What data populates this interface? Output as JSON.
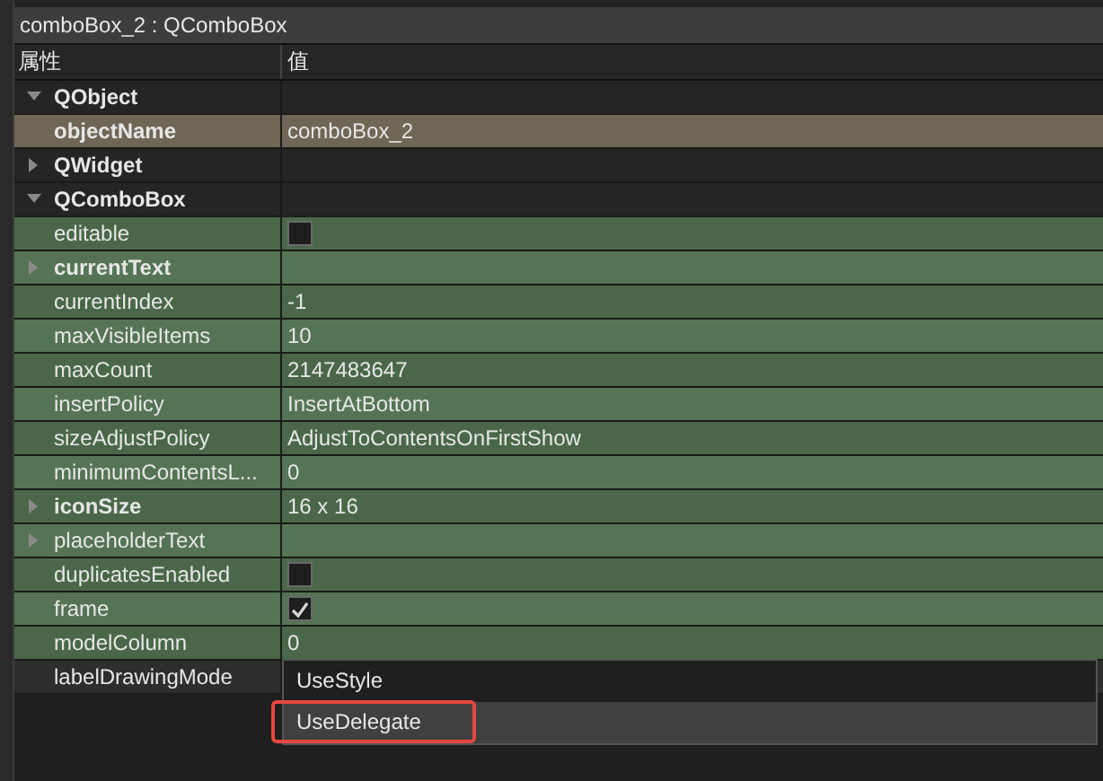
{
  "title": "comboBox_2 : QComboBox",
  "header": {
    "column_1": "属性",
    "column_2": "值"
  },
  "rows": [
    {
      "kind": "group",
      "name": "QObject",
      "expanded": true,
      "selected": false
    },
    {
      "kind": "property",
      "name": "objectName",
      "bold": true,
      "value": "comboBox_2",
      "selected": true
    },
    {
      "kind": "group",
      "name": "QWidget",
      "expanded": false,
      "selected": false
    },
    {
      "kind": "group",
      "name": "QComboBox",
      "expanded": true,
      "selected": false
    },
    {
      "kind": "property",
      "name": "editable",
      "bold": false,
      "checked": false,
      "selected": false
    },
    {
      "kind": "property",
      "name": "currentText",
      "bold": true,
      "expanded": false,
      "selected": false
    },
    {
      "kind": "property",
      "name": "currentIndex",
      "bold": false,
      "value": "-1",
      "selected": false
    },
    {
      "kind": "property",
      "name": "maxVisibleItems",
      "bold": false,
      "value": "10",
      "selected": false
    },
    {
      "kind": "property",
      "name": "maxCount",
      "bold": false,
      "value": "2147483647",
      "selected": false
    },
    {
      "kind": "property",
      "name": "insertPolicy",
      "bold": false,
      "value": "InsertAtBottom",
      "selected": false
    },
    {
      "kind": "property",
      "name": "sizeAdjustPolicy",
      "bold": false,
      "value": "AdjustToContentsOnFirstShow",
      "selected": false
    },
    {
      "kind": "property",
      "name": "minimumContentsL...",
      "bold": false,
      "value": "0",
      "selected": false
    },
    {
      "kind": "property",
      "name": "iconSize",
      "bold": true,
      "expanded": false,
      "value": "16 x 16",
      "selected": false
    },
    {
      "kind": "property",
      "name": "placeholderText",
      "bold": false,
      "expanded": false,
      "selected": false
    },
    {
      "kind": "property",
      "name": "duplicatesEnabled",
      "bold": false,
      "checked": false,
      "selected": false
    },
    {
      "kind": "property",
      "name": "frame",
      "bold": false,
      "checked": true,
      "selected": false
    },
    {
      "kind": "property",
      "name": "modelColumn",
      "bold": false,
      "value": "0",
      "selected": false
    },
    {
      "kind": "property",
      "name": "labelDrawingMode",
      "bold": false,
      "selected": false,
      "dropdown": [
        {
          "label": "UseStyle",
          "selected": false,
          "marked": false
        },
        {
          "label": "UseDelegate",
          "selected": true,
          "marked": true
        }
      ]
    }
  ]
}
